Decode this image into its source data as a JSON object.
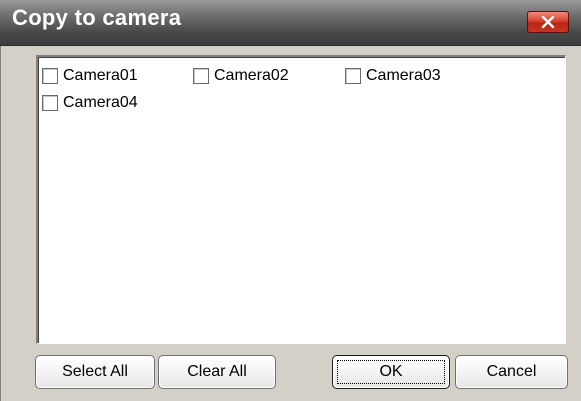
{
  "window": {
    "title": "Copy to camera",
    "close_icon": "close-x-icon",
    "close_color": "#c8331f"
  },
  "cameras": [
    {
      "label": "Camera01",
      "checked": false
    },
    {
      "label": "Camera02",
      "checked": false
    },
    {
      "label": "Camera03",
      "checked": false
    },
    {
      "label": "Camera04",
      "checked": false
    }
  ],
  "buttons": {
    "select_all": "Select All",
    "clear_all": "Clear All",
    "ok": "OK",
    "cancel": "Cancel"
  }
}
